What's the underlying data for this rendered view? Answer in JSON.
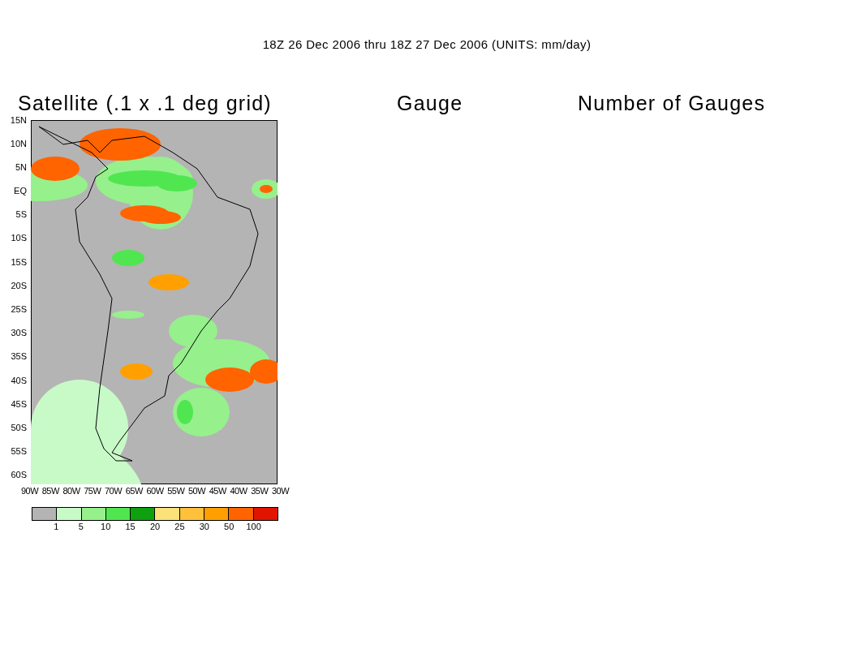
{
  "title": "18Z 26 Dec 2006 thru 18Z 27 Dec 2006 (UNITS: mm/day)",
  "panels": [
    {
      "title": "Satellite (.1 x .1 deg grid)"
    },
    {
      "title": "Gauge"
    },
    {
      "title": "Number of Gauges"
    }
  ],
  "map": {
    "y_labels": [
      "15N",
      "10N",
      "5N",
      "EQ",
      "5S",
      "10S",
      "15S",
      "20S",
      "25S",
      "30S",
      "35S",
      "40S",
      "45S",
      "50S",
      "55S",
      "60S"
    ],
    "x_labels": [
      "90W",
      "85W",
      "80W",
      "75W",
      "70W",
      "65W",
      "60W",
      "55W",
      "50W",
      "45W",
      "40W",
      "35W",
      "30W"
    ]
  },
  "colorbar": {
    "swatches": [
      {
        "color": "#b4b4b4"
      },
      {
        "color": "#c8fac8"
      },
      {
        "color": "#96f08c"
      },
      {
        "color": "#50e650"
      },
      {
        "color": "#0fa00f"
      },
      {
        "color": "#fae178"
      },
      {
        "color": "#ffc03c"
      },
      {
        "color": "#ffa000"
      },
      {
        "color": "#ff6400"
      },
      {
        "color": "#e11400"
      }
    ],
    "labels": [
      "1",
      "5",
      "10",
      "15",
      "20",
      "25",
      "30",
      "50",
      "100"
    ]
  }
}
